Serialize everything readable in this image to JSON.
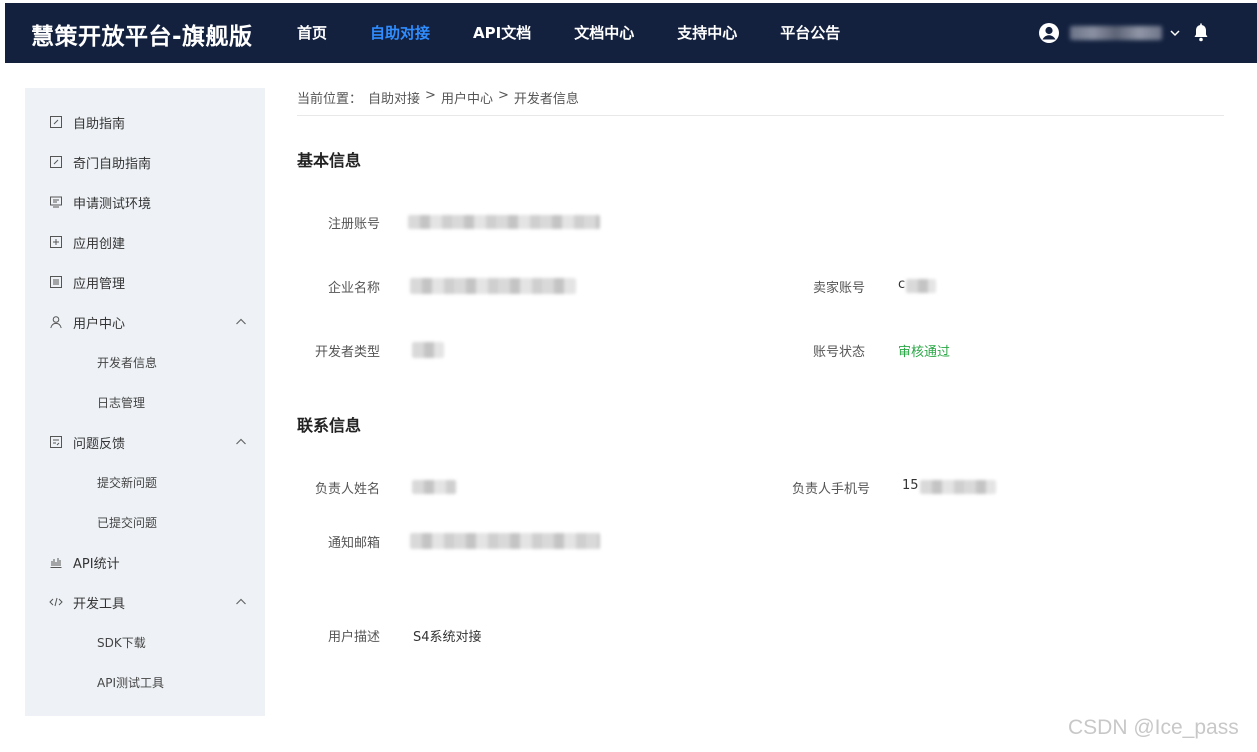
{
  "header": {
    "brand": "慧策开放平台-旗舰版",
    "nav": [
      "首页",
      "自助对接",
      "API文档",
      "文档中心",
      "支持中心",
      "平台公告"
    ],
    "active_nav_index": 1
  },
  "sidebar": {
    "items": [
      {
        "label": "自助指南",
        "icon": "edit-square-icon"
      },
      {
        "label": "奇门自助指南",
        "icon": "edit-square-icon"
      },
      {
        "label": "申请测试环境",
        "icon": "monitor-icon"
      },
      {
        "label": "应用创建",
        "icon": "add-square-icon"
      },
      {
        "label": "应用管理",
        "icon": "list-square-icon"
      },
      {
        "label": "用户中心",
        "icon": "user-icon",
        "expanded": true,
        "children": [
          "开发者信息",
          "日志管理"
        ]
      },
      {
        "label": "问题反馈",
        "icon": "feedback-icon",
        "expanded": true,
        "children": [
          "提交新问题",
          "已提交问题"
        ]
      },
      {
        "label": "API统计",
        "icon": "bar-chart-icon"
      },
      {
        "label": "开发工具",
        "icon": "code-icon",
        "expanded": true,
        "children": [
          "SDK下载",
          "API测试工具"
        ]
      }
    ]
  },
  "breadcrumb": {
    "prefix": "当前位置：",
    "path": [
      "自助对接",
      "用户中心",
      "开发者信息"
    ],
    "separator": ">"
  },
  "basic_info": {
    "title": "基本信息",
    "register_account_label": "注册账号",
    "company_name_label": "企业名称",
    "seller_account_label": "卖家账号",
    "seller_account_value": "c",
    "developer_type_label": "开发者类型",
    "account_status_label": "账号状态",
    "account_status_value": "审核通过"
  },
  "contact_info": {
    "title": "联系信息",
    "owner_name_label": "负责人姓名",
    "owner_phone_label": "负责人手机号",
    "owner_phone_value": "15",
    "email_label": "通知邮箱",
    "description_label": "用户描述",
    "description_value": "S4系统对接"
  },
  "colors": {
    "topbar": "#13213f",
    "active_nav": "#2f8dff",
    "sidebar_bg": "#eef2f6",
    "status_ok": "#29a745"
  },
  "watermark": "CSDN @Ice_pass"
}
